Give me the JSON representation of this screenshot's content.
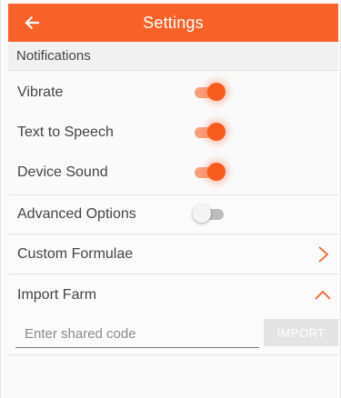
{
  "app_bar": {
    "title": "Settings",
    "back_icon": "arrow-left-icon",
    "color": "#f86228"
  },
  "notifications": {
    "header": "Notifications",
    "items": [
      {
        "label": "Vibrate",
        "on": true
      },
      {
        "label": "Text to Speech",
        "on": true
      },
      {
        "label": "Device Sound",
        "on": true
      }
    ]
  },
  "advanced_options": {
    "label": "Advanced Options",
    "on": false
  },
  "custom_formulae": {
    "label": "Custom Formulae",
    "icon": "chevron-right-icon"
  },
  "import_farm": {
    "label": "Import Farm",
    "icon": "chevron-up-icon",
    "input_placeholder": "Enter shared code",
    "input_value": "",
    "button_label": "IMPORT",
    "button_enabled": false
  },
  "accent_color": "#f86228"
}
